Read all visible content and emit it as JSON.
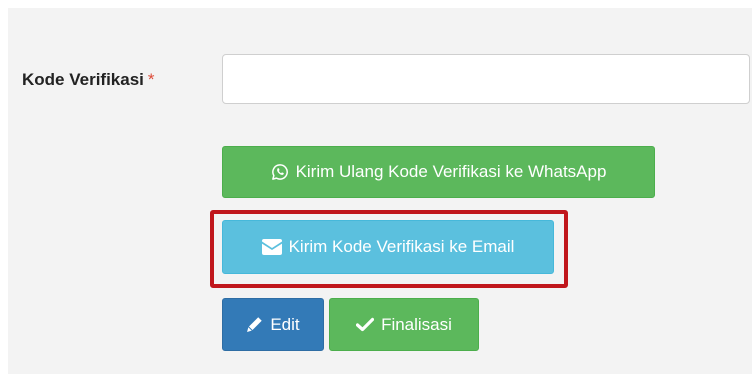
{
  "form": {
    "verification_code": {
      "label": "Kode Verifikasi",
      "required_marker": "*",
      "value": "",
      "placeholder": ""
    }
  },
  "actions": {
    "resend_whatsapp": {
      "label": "Kirim Ulang Kode Verifikasi ke WhatsApp",
      "icon": "whatsapp-icon",
      "color": "#5cb85c"
    },
    "send_email": {
      "label": "Kirim Kode Verifikasi ke Email",
      "icon": "envelope-icon",
      "color": "#5bc0de",
      "highlighted": true,
      "highlight_color": "#c0161c"
    },
    "edit": {
      "label": "Edit",
      "icon": "pencil-icon",
      "color": "#337ab7"
    },
    "finalize": {
      "label": "Finalisasi",
      "icon": "checkmark-icon",
      "color": "#5cb85c"
    }
  }
}
